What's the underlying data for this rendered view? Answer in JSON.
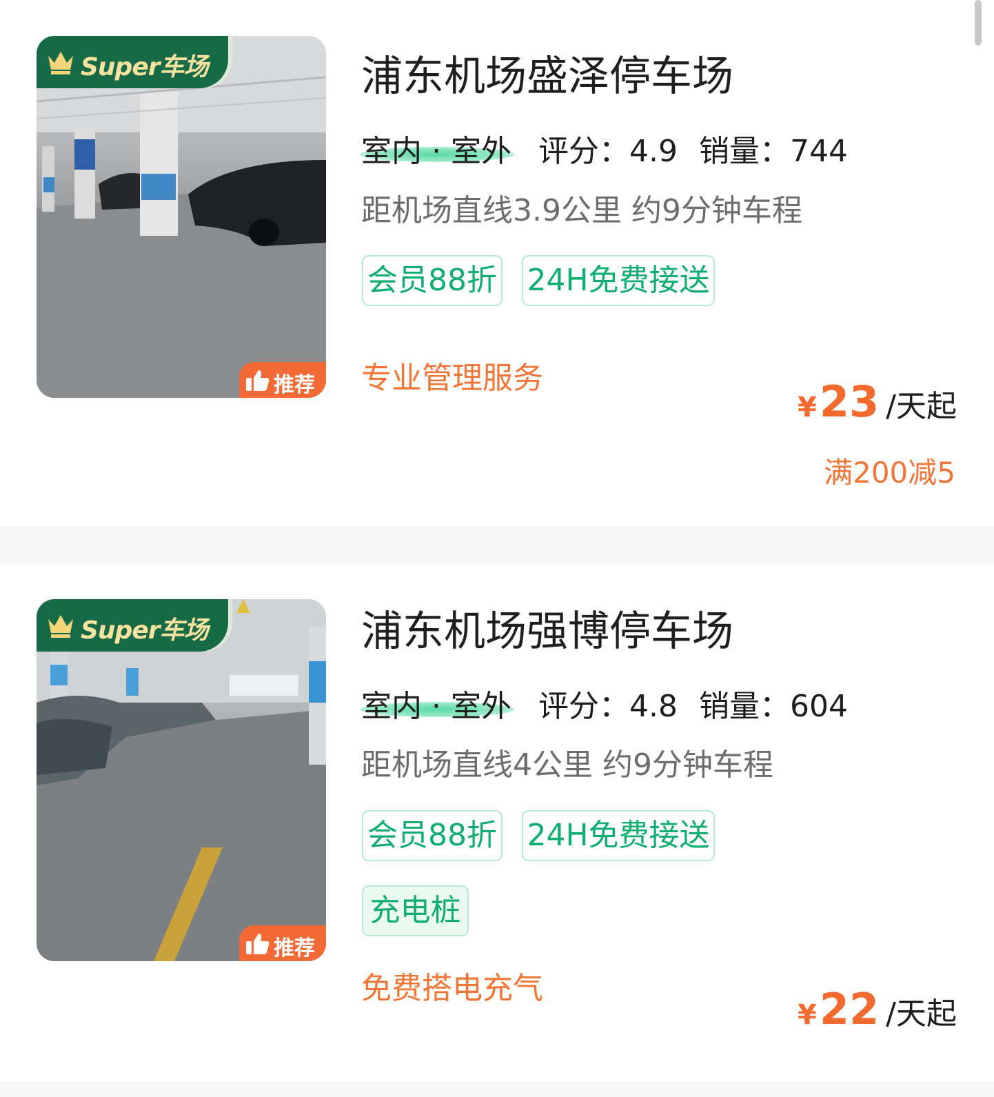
{
  "listings": [
    {
      "super_badge": "Super车场",
      "recommend_badge": "推荐",
      "name": "浦东机场盛泽停车场",
      "type": "室内 · 室外",
      "rating": "评分：4.9",
      "sales": "销量：744",
      "distance": "距机场直线3.9公里 约9分钟车程",
      "tags": [
        "会员88折",
        "24H免费接送"
      ],
      "feature": "专业管理服务",
      "price_currency": "¥",
      "price_amount": "23",
      "price_unit": "/天起",
      "discount": "满200减5"
    },
    {
      "super_badge": "Super车场",
      "recommend_badge": "推荐",
      "name": "浦东机场强博停车场",
      "type": "室内 · 室外",
      "rating": "评分：4.8",
      "sales": "销量：604",
      "distance": "距机场直线4公里 约9分钟车程",
      "tags": [
        "会员88折",
        "24H免费接送",
        "充电桩"
      ],
      "feature": "免费搭电充气",
      "price_currency": "¥",
      "price_amount": "22",
      "price_unit": "/天起"
    }
  ],
  "colors": {
    "accent_green": "#10ad71",
    "price_orange": "#f26a2e",
    "badge_green": "#166a45",
    "recommend_orange": "#f46a37"
  },
  "icons": [
    "crown-icon",
    "thumbs-up-icon"
  ]
}
